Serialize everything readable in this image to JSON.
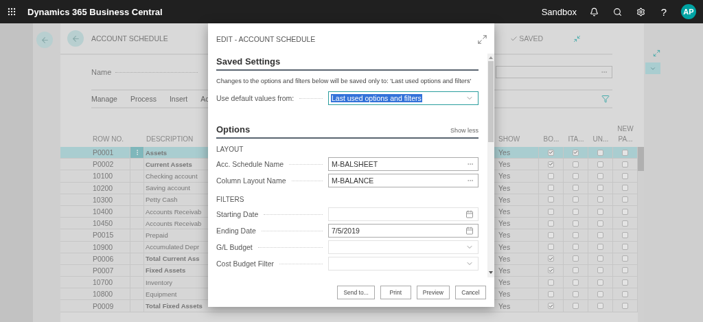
{
  "top_bar": {
    "app_title": "Dynamics 365 Business Central",
    "environment": "Sandbox",
    "help": "?",
    "avatar": "AP"
  },
  "page": {
    "title": "ACCOUNT SCHEDULE",
    "status": "SAVED",
    "name_label": "Name",
    "actions": [
      "Manage",
      "Process",
      "Insert",
      "Ac"
    ],
    "table": {
      "columns": [
        {
          "label": "ROW NO."
        },
        {
          "label": "DESCRIPTION"
        },
        {
          "label": "SHOW"
        },
        {
          "label": "BO..."
        },
        {
          "label": "ITA..."
        },
        {
          "label": "UN..."
        },
        {
          "label": "NEW PA..."
        }
      ],
      "rows": [
        {
          "row_no": "P0001",
          "description": "Assets",
          "bold": true,
          "show": "Yes",
          "flags": [
            true,
            true,
            false,
            false
          ],
          "selected": true
        },
        {
          "row_no": "P0002",
          "description": "Current Assets",
          "bold": true,
          "show": "Yes",
          "flags": [
            true,
            false,
            false,
            false
          ],
          "selected": false
        },
        {
          "row_no": "10100",
          "description": "Checking account",
          "bold": false,
          "show": "Yes",
          "flags": [
            false,
            false,
            false,
            false
          ],
          "selected": false
        },
        {
          "row_no": "10200",
          "description": "Saving account",
          "bold": false,
          "show": "Yes",
          "flags": [
            false,
            false,
            false,
            false
          ],
          "selected": false
        },
        {
          "row_no": "10300",
          "description": "Petty Cash",
          "bold": false,
          "show": "Yes",
          "flags": [
            false,
            false,
            false,
            false
          ],
          "selected": false
        },
        {
          "row_no": "10400",
          "description": "Accounts Receivab",
          "bold": false,
          "show": "Yes",
          "flags": [
            false,
            false,
            false,
            false
          ],
          "selected": false
        },
        {
          "row_no": "10450",
          "description": "Accounts Receivab",
          "bold": false,
          "show": "Yes",
          "flags": [
            false,
            false,
            false,
            false
          ],
          "selected": false
        },
        {
          "row_no": "P0015",
          "description": "Prepaid",
          "bold": false,
          "show": "Yes",
          "flags": [
            false,
            false,
            false,
            false
          ],
          "selected": false
        },
        {
          "row_no": "10900",
          "description": "Accumulated Depr",
          "bold": false,
          "show": "Yes",
          "flags": [
            false,
            false,
            false,
            false
          ],
          "selected": false
        },
        {
          "row_no": "P0006",
          "description": "Total Current Ass",
          "bold": true,
          "show": "Yes",
          "flags": [
            true,
            false,
            false,
            false
          ],
          "selected": false
        },
        {
          "row_no": "P0007",
          "description": "Fixed Assets",
          "bold": true,
          "show": "Yes",
          "flags": [
            true,
            false,
            false,
            false
          ],
          "selected": false
        },
        {
          "row_no": "10700",
          "description": "Inventory",
          "bold": false,
          "show": "Yes",
          "flags": [
            false,
            false,
            false,
            false
          ],
          "selected": false
        },
        {
          "row_no": "10800",
          "description": "Equipment",
          "bold": false,
          "show": "Yes",
          "flags": [
            false,
            false,
            false,
            false
          ],
          "selected": false
        },
        {
          "row_no": "P0009",
          "description": "Total Fixed Assets",
          "bold": true,
          "show": "Yes",
          "flags": [
            true,
            false,
            false,
            false
          ],
          "selected": false
        }
      ]
    }
  },
  "dialog": {
    "title": "EDIT - ACCOUNT SCHEDULE",
    "saved_settings": {
      "heading": "Saved Settings",
      "note": "Changes to the options and filters below will be saved only to: 'Last used options and filters'",
      "field": {
        "label": "Use default values from:",
        "kind": "select",
        "value": "Last used options and filters",
        "highlighted": true
      }
    },
    "options": {
      "heading": "Options",
      "toggle": "Show less",
      "groups": [
        {
          "caption": "LAYOUT",
          "fields": [
            {
              "label": "Acc. Schedule Name",
              "kind": "lookup",
              "value": "M-BALSHEET"
            },
            {
              "label": "Column Layout Name",
              "kind": "lookup",
              "value": "M-BALANCE"
            }
          ]
        },
        {
          "caption": "FILTERS",
          "fields": [
            {
              "label": "Starting Date",
              "kind": "date"
            },
            {
              "label": "Ending Date",
              "kind": "date",
              "value": "7/5/2019"
            },
            {
              "label": "G/L Budget",
              "kind": "select"
            },
            {
              "label": "Cost Budget Filter",
              "kind": "select"
            }
          ]
        }
      ]
    },
    "buttons": [
      "Send to...",
      "Print",
      "Preview",
      "Cancel"
    ]
  }
}
